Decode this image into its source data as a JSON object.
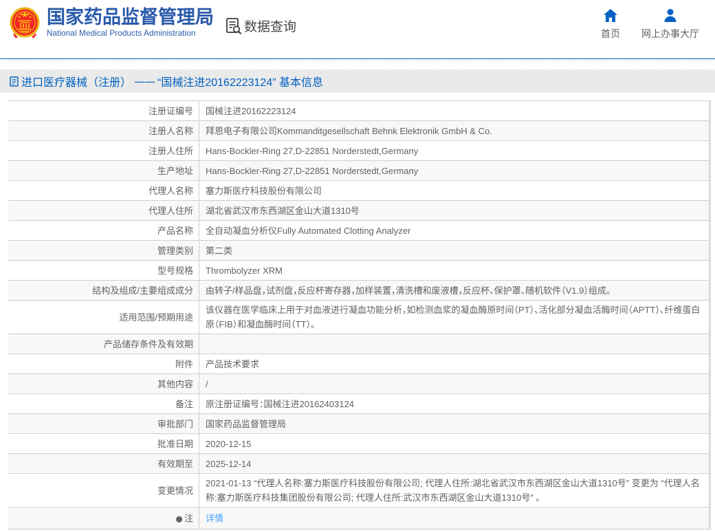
{
  "header": {
    "org_name_zh": "国家药品监督管理局",
    "org_name_en": "National Medical Products Administration",
    "data_query_label": "数据查询",
    "nav": [
      {
        "label": "首页",
        "icon": "home-icon"
      },
      {
        "label": "网上办事大厅",
        "icon": "user-icon"
      }
    ]
  },
  "breadcrumb": {
    "category": "进口医疗器械（注册）",
    "dash": "——",
    "title": "“国械注进20162223124” 基本信息"
  },
  "table": {
    "rows": [
      {
        "label": "注册证编号",
        "value": "国械注进20162223124"
      },
      {
        "label": "注册人名称",
        "value": "拜恩电子有限公司Kommanditgesellschaft Behnk Elektronik GmbH & Co."
      },
      {
        "label": "注册人住所",
        "value": "Hans-Bockler-Ring 27,D-22851 Norderstedt,Germany"
      },
      {
        "label": "生产地址",
        "value": "Hans-Bockler-Ring 27,D-22851 Norderstedt,Germany"
      },
      {
        "label": "代理人名称",
        "value": "塞力斯医疗科技股份有限公司"
      },
      {
        "label": "代理人住所",
        "value": "湖北省武汉市东西湖区金山大道1310号"
      },
      {
        "label": "产品名称",
        "value": "全自动凝血分析仪Fully Automated Clotting Analyzer"
      },
      {
        "label": "管理类别",
        "value": "第二类"
      },
      {
        "label": "型号规格",
        "value": "Thrombolyzer XRM"
      },
      {
        "label": "结构及组成/主要组成成分",
        "value": "由转子/样品盘，试剂盘，反应杯寄存器，加样装置，清洗槽和废液槽，反应杯、保护罩、随机软件（V1.9）组成。"
      },
      {
        "label": "适用范围/预期用途",
        "value": "该仪器在医学临床上用于对血液进行凝血功能分析，如检测血浆的凝血酶原时间（PT）、活化部分凝血活酶时间（APTT）、纤维蛋白原（FIB）和凝血酶时间（TT）。"
      },
      {
        "label": "产品储存条件及有效期",
        "value": ""
      },
      {
        "label": "附件",
        "value": "产品技术要求"
      },
      {
        "label": "其他内容",
        "value": "/"
      },
      {
        "label": "备注",
        "value": "原注册证编号：国械注进20162403124"
      },
      {
        "label": "审批部门",
        "value": "国家药品监督管理局"
      },
      {
        "label": "批准日期",
        "value": "2020-12-15"
      },
      {
        "label": "有效期至",
        "value": "2025-12-14"
      },
      {
        "label": "变更情况",
        "value": "2021-01-13 “代理人名称:塞力斯医疗科技股份有限公司; 代理人住所:湖北省武汉市东西湖区金山大道1310号” 变更为 “代理人名称:塞力斯医疗科技集团股份有限公司; 代理人住所:武汉市东西湖区金山大道1310号” 。"
      },
      {
        "label": "注",
        "bullet": "●",
        "value": "详情",
        "link": true
      }
    ]
  },
  "colors": {
    "accent_blue": "#0061c3",
    "brand_blue": "#2a5aaa",
    "link_blue": "#409eff",
    "text_dark": "#46474c",
    "text_gray": "#606266",
    "border": "#d0cece",
    "stripe": "#f8f8f8",
    "crumb_bg": "#eaeaea",
    "emblem_red": "#f42524",
    "emblem_gold": "#f7c11e"
  }
}
